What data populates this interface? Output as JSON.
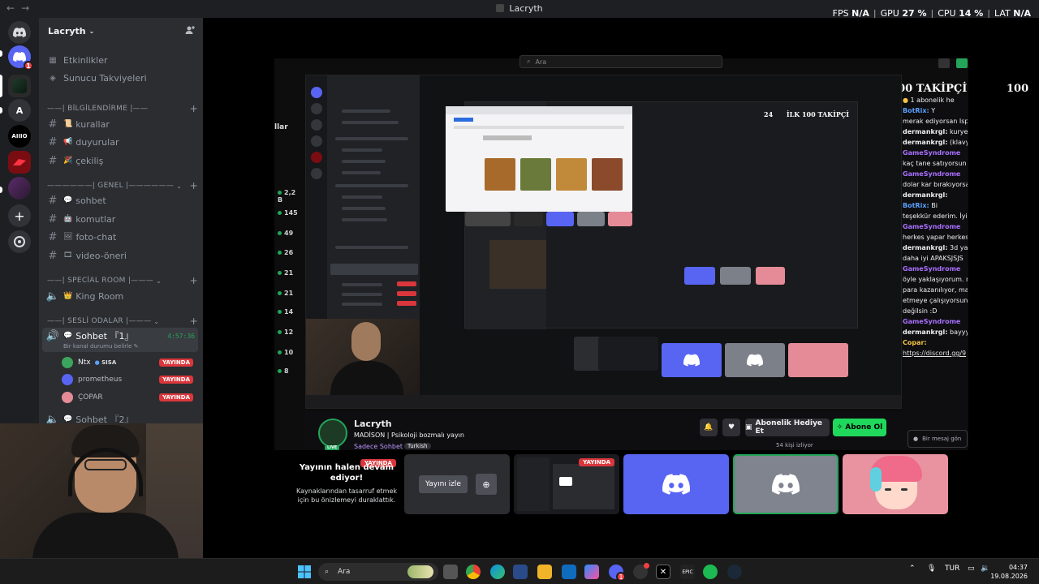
{
  "window": {
    "title": "Lacryth",
    "nav_back": "←",
    "nav_forward": "→"
  },
  "perf": {
    "fps_label": "FPS",
    "fps_value": "N/A",
    "gpu_label": "GPU",
    "gpu_value": "27 %",
    "cpu_label": "CPU",
    "cpu_value": "14 %",
    "lat_label": "LAT",
    "lat_value": "N/A",
    "sep": "|"
  },
  "rail": {
    "dm_badge": "1",
    "server_letter": "A",
    "server_aiiio": "AIIIO"
  },
  "server": {
    "name": "Lacryth",
    "events": "Etkinlikler",
    "boosts": "Sunucu Takviyeleri",
    "categories": [
      {
        "label": "——| BİLGİLENDİRME |——"
      },
      {
        "label": "——————| GENEL |——————"
      },
      {
        "label": "——| SPECİAL ROOM |———"
      },
      {
        "label": "——| SESLİ ODALAR |———"
      }
    ],
    "channels": {
      "kurallar": "kurallar",
      "duyurular": "duyurular",
      "cekilis": "çekiliş",
      "sohbet": "sohbet",
      "komutlar": "komutlar",
      "foto_chat": "foto-chat",
      "video_oneri": "video-öneri",
      "king_room": "King Room"
    },
    "voice": {
      "name": "Sohbet 『1』",
      "time": "4:57:36",
      "status": "Bir kanal durumu belirle",
      "members": [
        {
          "name": "Ntx",
          "tag": "SISA",
          "live": "YAYINDA"
        },
        {
          "name": "prometheus",
          "live": "YAYINDA"
        },
        {
          "name": "ÇOPAR",
          "live": "YAYINDA"
        }
      ],
      "second": "Sohbet 『2』"
    }
  },
  "stream": {
    "search_placeholder": "Ara",
    "follow_left": "24",
    "follow_title": "İLK 100 TAKİPÇİ",
    "follow_right": "100",
    "nested_left": "24",
    "nested_title": "İLK 100 TAKİPÇİ",
    "side_numbers": [
      "2,2 B",
      "145",
      "49",
      "26",
      "21",
      "21",
      "14",
      "12",
      "10",
      "8"
    ],
    "side_label": "llar",
    "streamer": "Lacryth",
    "stream_title": "MADİSON | Psikoloji bozmalı yayın",
    "category": "Sadece Sohbet",
    "tag": "Turkish",
    "gift_button": "Abonelik Hediye Et",
    "subscribe_button": "Abone Ol",
    "viewers": "54 kişi izliyor",
    "message_placeholder": "Bir mesaj gön",
    "avatar_live": "LIVE"
  },
  "chat": {
    "header": "1 abonelik he",
    "lines": [
      {
        "user": "BotRix:",
        "text": "Y",
        "cls": "u-b"
      },
      {
        "user": "",
        "text": "merak ediyorsan Isp",
        "cls": ""
      },
      {
        "user": "dermankrgl:",
        "text": "kurye",
        "cls": "u-g"
      },
      {
        "user": "dermankrgl:",
        "text": "(klavye",
        "cls": "u-g"
      },
      {
        "user": "GameSyndrome",
        "text": "",
        "cls": "u-p"
      },
      {
        "user": "",
        "text": "kaç tane satıyorsun",
        "cls": ""
      },
      {
        "user": "GameSyndrome",
        "text": "",
        "cls": "u-p"
      },
      {
        "user": "",
        "text": "dolar kar bırakıyorsa",
        "cls": ""
      },
      {
        "user": "dermankrgl:",
        "text": "",
        "cls": "u-g"
      },
      {
        "user": "BotRix:",
        "text": "Bi",
        "cls": "u-b"
      },
      {
        "user": "",
        "text": "teşekkür ederim. İyi",
        "cls": ""
      },
      {
        "user": "GameSyndrome",
        "text": "",
        "cls": "u-p"
      },
      {
        "user": "",
        "text": "herkes yapar herkes",
        "cls": ""
      },
      {
        "user": "dermankrgl:",
        "text": "3d yazı",
        "cls": "u-g"
      },
      {
        "user": "",
        "text": "daha iyi APAKSJSJS",
        "cls": ""
      },
      {
        "user": "GameSyndrome",
        "text": "",
        "cls": "u-p"
      },
      {
        "user": "",
        "text": "öyle yaklaşıyorum. n",
        "cls": ""
      },
      {
        "user": "",
        "text": "para kazanılıyor, ma",
        "cls": ""
      },
      {
        "user": "",
        "text": "etmeye çalışıyorsun",
        "cls": ""
      },
      {
        "user": "",
        "text": "değilsin :D",
        "cls": ""
      },
      {
        "user": "GameSyndrome",
        "text": "",
        "cls": "u-p"
      },
      {
        "user": "dermankrgl:",
        "text": "bayyy",
        "cls": "u-g"
      },
      {
        "user": "Copar:",
        "text": "",
        "cls": "u-y"
      },
      {
        "user": "",
        "text": "https://discord.gg/9",
        "cls": "lnk"
      }
    ]
  },
  "tiles": {
    "paused_title": "Yayının halen devam ediyor!",
    "paused_sub": "Kaynaklarından tasarruf etmek için bu önizlemeyi duraklattık.",
    "live_badge": "YAYINDA",
    "watch_button": "Yayını izle"
  },
  "taskbar": {
    "search": "Ara",
    "language": "TUR",
    "time": "04:37",
    "date": "19.08.2026",
    "discord_badge": "1"
  }
}
